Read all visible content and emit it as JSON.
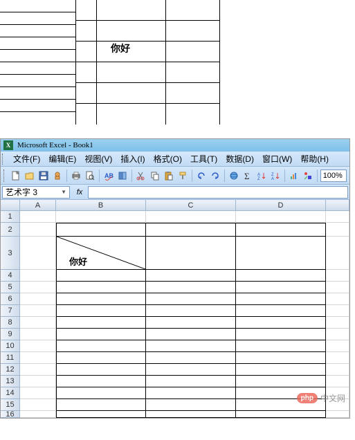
{
  "preview": {
    "text_cell": "你好"
  },
  "window": {
    "app_name": "Microsoft Excel",
    "doc_name": "Book1",
    "title_separator": " - "
  },
  "menu": {
    "file": "文件(F)",
    "edit": "编辑(E)",
    "view": "视图(V)",
    "insert": "插入(I)",
    "format": "格式(O)",
    "tools": "工具(T)",
    "data": "数据(D)",
    "window": "窗口(W)",
    "help": "帮助(H)"
  },
  "toolbar": {
    "zoom": "100%"
  },
  "formula_bar": {
    "name_box": "艺术字 3",
    "fx_label": "fx"
  },
  "grid": {
    "columns": [
      "A",
      "B",
      "C",
      "D"
    ],
    "rows": [
      1,
      2,
      3,
      4,
      5,
      6,
      7,
      8,
      9,
      10,
      11,
      12,
      13,
      14,
      15,
      16
    ],
    "b3_text": "你好"
  },
  "watermark": {
    "logo": "php",
    "text": "中文网"
  },
  "colors": {
    "titlebar": "#8cc8ea",
    "menubar": "#cde1f6",
    "header_grad_a": "#f0f4fa",
    "header_grad_b": "#d0dcec"
  }
}
